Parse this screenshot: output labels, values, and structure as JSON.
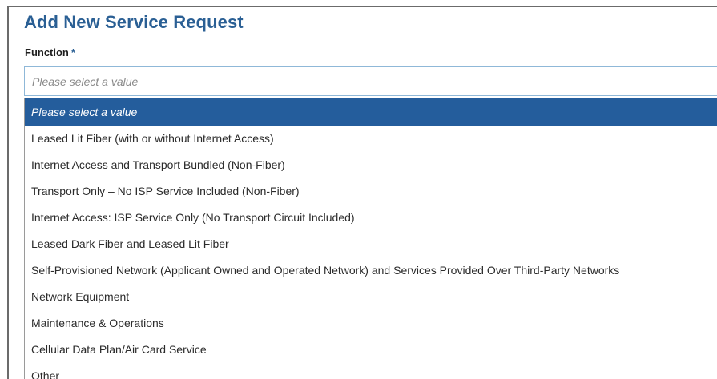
{
  "form": {
    "title": "Add New Service Request",
    "function_label": "Function",
    "required_marker": "*",
    "select": {
      "placeholder": "Please select a value"
    },
    "options": [
      "Please select a value",
      "Leased Lit Fiber (with or without Internet Access)",
      "Internet Access and Transport Bundled (Non-Fiber)",
      "Transport Only – No ISP Service Included (Non-Fiber)",
      "Internet Access: ISP Service Only (No Transport Circuit Included)",
      "Leased Dark Fiber and Leased Lit Fiber",
      "Self-Provisioned Network (Applicant Owned and Operated Network) and Services Provided Over Third-Party Networks",
      "Network Equipment",
      "Maintenance & Operations",
      "Cellular Data Plan/Air Card Service",
      "Other"
    ],
    "highlighted_option_index": 0
  },
  "colors": {
    "title": "#2a5f94",
    "highlight": "#245d9c",
    "select_border": "#8fb8d8"
  }
}
